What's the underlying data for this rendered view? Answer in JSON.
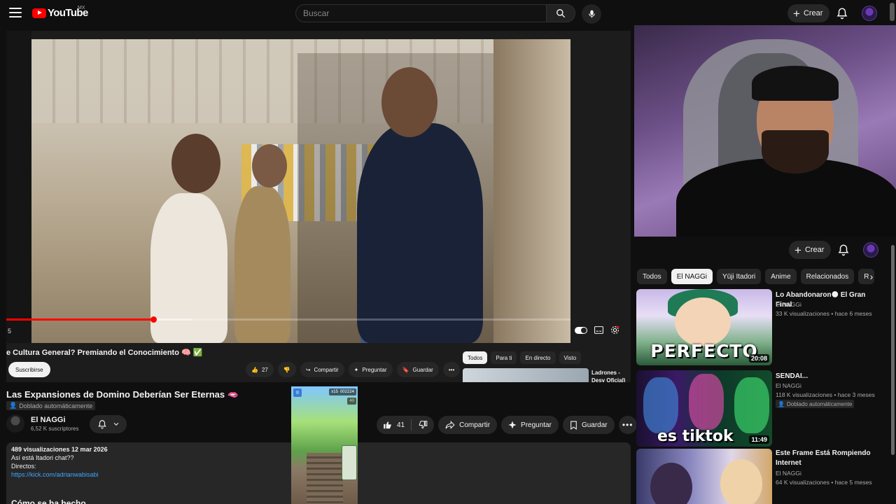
{
  "header": {
    "logo_text": "YouTube",
    "logo_region": "MX",
    "search_placeholder": "Buscar",
    "create_label": "Crear"
  },
  "player": {
    "progress_fraction": 0.26,
    "time_stub": "5",
    "mini_title": "e Cultura General? Premiando el Conocimiento 🧠 ✅",
    "mini_subscribe": "Suscribirse",
    "mini_like_count": "27",
    "mini_share": "Compartir",
    "mini_ask": "Preguntar",
    "mini_save": "Guardar",
    "mini_chips": [
      "Todos",
      "Para ti",
      "En directo",
      "Visto"
    ],
    "mini_side_title": "Ladrones - Desv Oficial)"
  },
  "video": {
    "title": "Las Expansiones de Domino Deberían Ser Eternas 🫦",
    "dubbed_badge": "Doblado automáticamente",
    "channel_name": "El NAGGi",
    "channel_subs": "6,52 K suscriptores",
    "like_count": "41",
    "share_label": "Compartir",
    "ask_label": "Preguntar",
    "save_label": "Guardar"
  },
  "description": {
    "stats": "489 visualizaciones  12 mar 2026",
    "line1": "Así está Itadori chat??",
    "line2": "Directos:",
    "link": "https://kick.com/adrianwabisabi",
    "heading": "Cómo se ha hecho"
  },
  "game": {
    "score": "002224",
    "multiplier": "x15",
    "coins": "40"
  },
  "right": {
    "create_label": "Crear",
    "chips": [
      "Todos",
      "El NAGGi",
      "Yūji Itadori",
      "Anime",
      "Relacionados",
      "R"
    ],
    "active_chip": 1
  },
  "recommendations": [
    {
      "title": "Lo Abandonaron🌑 El Gran Final",
      "channel": "El NAGGi",
      "meta": "33 K visualizaciones • hace 6 meses",
      "duration": "20:08",
      "thumb_text": "PERFECTO"
    },
    {
      "title": "SENDAI...",
      "channel": "El NAGGi",
      "meta": "118 K visualizaciones • hace 3 meses",
      "badge": "Doblado automáticamente",
      "duration": "11:49",
      "thumb_text": "es tiktok"
    },
    {
      "title": "Este Frame Está Rompiendo Internet",
      "channel": "El NAGGi",
      "meta": "64 K visualizaciones • hace 5 meses"
    }
  ],
  "colors": {
    "background": "#0f0f0f",
    "pill": "#272727",
    "accent_red": "#ff0000",
    "link_blue": "#3ea6ff"
  }
}
